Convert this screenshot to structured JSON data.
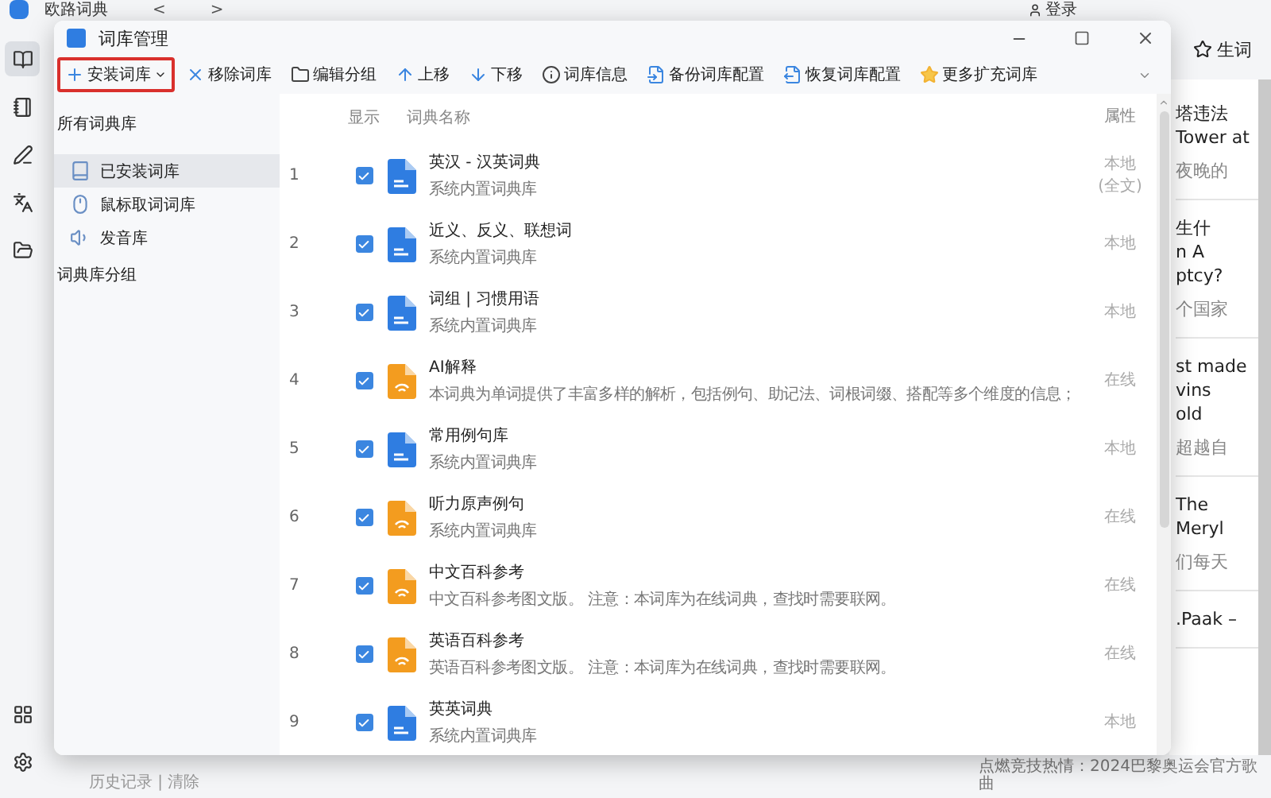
{
  "app": {
    "title": "欧路词典",
    "nav": [
      "<",
      ">"
    ],
    "login": "登录",
    "wordbook": "生词",
    "history": "历史记录 | 清除"
  },
  "rail": [
    {
      "kind": "book",
      "selected": true
    },
    {
      "kind": "notebook",
      "selected": false
    },
    {
      "kind": "pen",
      "selected": false
    },
    {
      "kind": "translate",
      "selected": false
    },
    {
      "kind": "folder",
      "selected": false
    }
  ],
  "rail_bottom": [
    {
      "kind": "apps"
    },
    {
      "kind": "settings"
    }
  ],
  "articles": [
    {
      "lines": [
        "塔违法",
        "Tower at"
      ],
      "sub": "夜晚的"
    },
    {
      "lines": [
        "生什",
        "n A",
        "ptcy?"
      ],
      "sub": "个国家"
    },
    {
      "lines": [
        "st made",
        "vins",
        "old"
      ],
      "sub": "超越自"
    },
    {
      "lines": [
        "The",
        "Meryl"
      ],
      "sub": "们每天"
    },
    {
      "lines": [
        ".Paak –"
      ]
    }
  ],
  "caption": "点燃竞技热情：2024巴黎奥运会官方歌曲",
  "dialog": {
    "title": "词库管理",
    "toolbar": [
      {
        "kind": "add",
        "label": "安装词库",
        "highlighted": true,
        "dropdown": true
      },
      {
        "kind": "remove",
        "label": "移除词库",
        "highlighted": false,
        "dropdown": false
      },
      {
        "kind": "group",
        "label": "编辑分组",
        "highlighted": false,
        "dropdown": false
      },
      {
        "kind": "up",
        "label": "上移",
        "highlighted": false,
        "dropdown": false
      },
      {
        "kind": "down",
        "label": "下移",
        "highlighted": false,
        "dropdown": false
      },
      {
        "kind": "info",
        "label": "词库信息",
        "highlighted": false,
        "dropdown": false
      },
      {
        "kind": "backup",
        "label": "备份词库配置",
        "highlighted": false,
        "dropdown": false
      },
      {
        "kind": "restore",
        "label": "恢复词库配置",
        "highlighted": false,
        "dropdown": false
      },
      {
        "kind": "more",
        "label": "更多扩充词库",
        "highlighted": false,
        "dropdown": false
      }
    ],
    "sidebar": {
      "heading": "所有词典库",
      "items": [
        {
          "kind": "installed",
          "label": "已安装词库",
          "selected": true
        },
        {
          "kind": "mouse",
          "label": "鼠标取词词库",
          "selected": false
        },
        {
          "kind": "sound",
          "label": "发音库",
          "selected": false
        }
      ],
      "group_heading": "词典库分组"
    },
    "table": {
      "columns": [
        "显示",
        "词典名称",
        "属性"
      ],
      "rows": [
        {
          "index": "1",
          "checked": true,
          "kind": "local",
          "name": "英汉 - 汉英词典",
          "desc": "系统内置词典库",
          "attr": [
            "本地",
            "(全文)"
          ]
        },
        {
          "index": "2",
          "checked": true,
          "kind": "local",
          "name": "近义、反义、联想词",
          "desc": "系统内置词典库",
          "attr": [
            "本地"
          ]
        },
        {
          "index": "3",
          "checked": true,
          "kind": "local",
          "name": "词组 | 习惯用语",
          "desc": "系统内置词典库",
          "attr": [
            "本地"
          ]
        },
        {
          "index": "4",
          "checked": true,
          "kind": "online",
          "name": "AI解释",
          "desc": "本词典为单词提供了丰富多样的解析，包括例句、助记法、词根词缀、搭配等多个维度的信息；",
          "attr": [
            "在线"
          ]
        },
        {
          "index": "5",
          "checked": true,
          "kind": "local",
          "name": "常用例句库",
          "desc": "系统内置词典库",
          "attr": [
            "本地"
          ]
        },
        {
          "index": "6",
          "checked": true,
          "kind": "online",
          "name": "听力原声例句",
          "desc": "系统内置词典库",
          "attr": [
            "在线"
          ]
        },
        {
          "index": "7",
          "checked": true,
          "kind": "online",
          "name": "中文百科参考",
          "desc": "中文百科参考图文版。 注意：本词库为在线词典，查找时需要联网。",
          "attr": [
            "在线"
          ]
        },
        {
          "index": "8",
          "checked": true,
          "kind": "online",
          "name": "英语百科参考",
          "desc": "英语百科参考图文版。 注意：本词库为在线词典，查找时需要联网。",
          "attr": [
            "在线"
          ]
        },
        {
          "index": "9",
          "checked": true,
          "kind": "local",
          "name": "英英词典",
          "desc": "系统内置词典库",
          "attr": [
            "本地"
          ]
        }
      ]
    }
  }
}
